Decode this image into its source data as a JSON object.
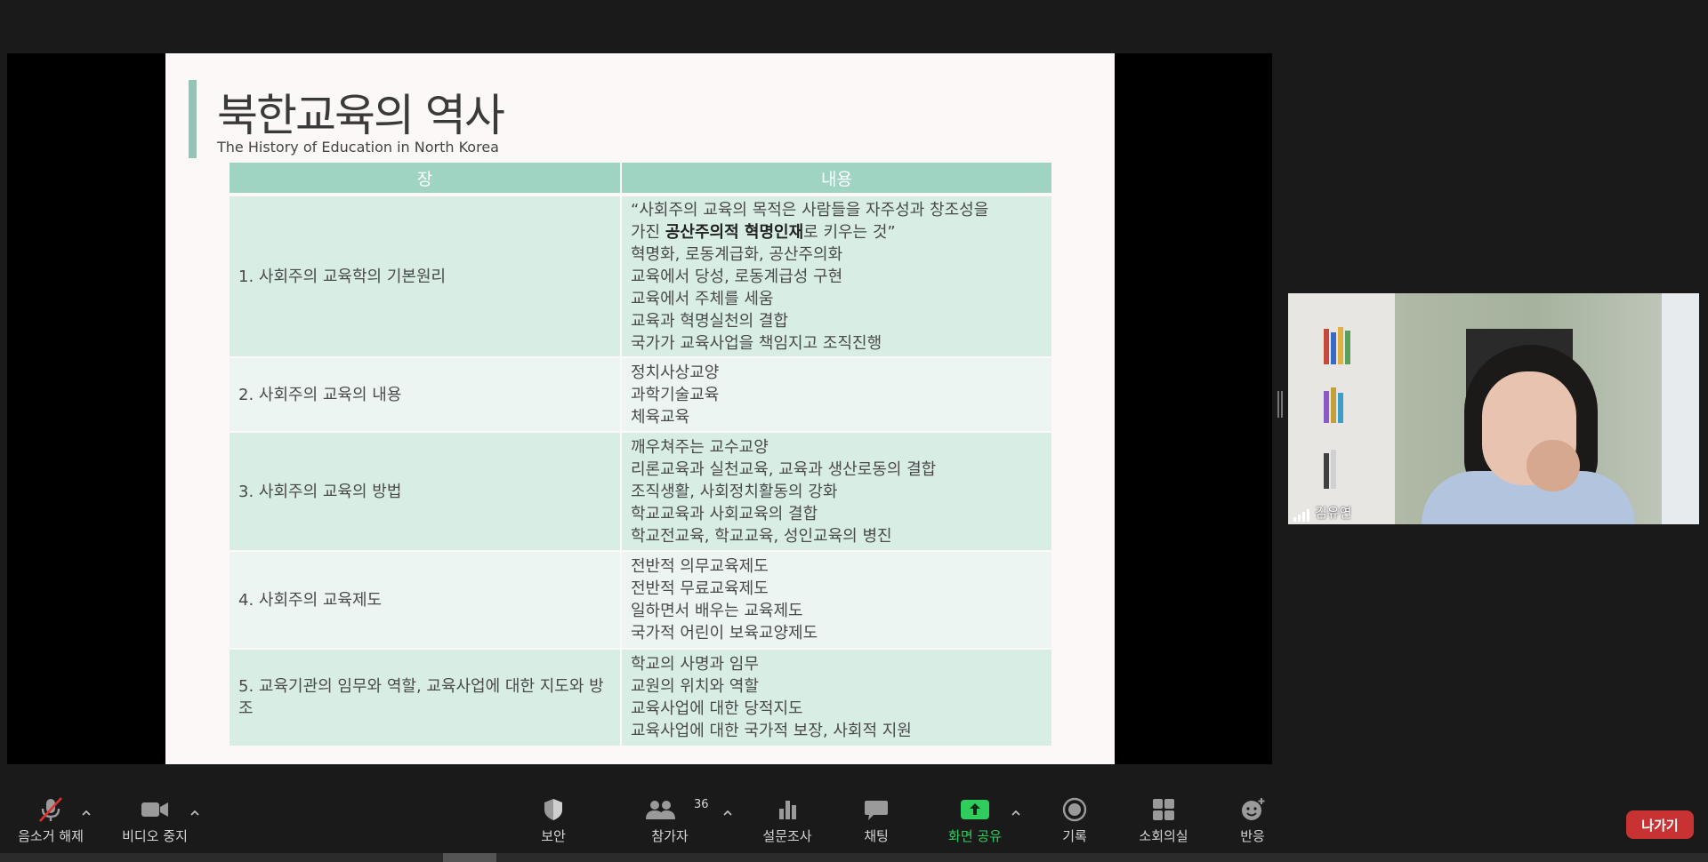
{
  "slide": {
    "title": "북한교육의 역사",
    "subtitle": "The History of Education in North Korea",
    "table": {
      "headers": [
        "장",
        "내용"
      ],
      "rows": [
        {
          "chapter": "1. 사회주의 교육학의 기본원리",
          "lines": [
            "“사회주의 교육의 목적은 사람들을 자주성과 창조성을",
            "가진 ",
            "혁명화, 로동계급화, 공산주의화",
            "교육에서 당성, 로동계급성 구현",
            "교육에서 주체를 세움",
            "교육과 혁명실천의 결합",
            "국가가 교육사업을 책임지고 조직진행"
          ],
          "bold_phrase": "공산주의적 혁명인재",
          "after_bold": "로 키우는 것”"
        },
        {
          "chapter": "2. 사회주의 교육의 내용",
          "lines": [
            "정치사상교양",
            "과학기술교육",
            "체육교육"
          ]
        },
        {
          "chapter": "3. 사회주의 교육의 방법",
          "lines": [
            "깨우쳐주는 교수교양",
            "리론교육과 실천교육, 교육과 생산로동의 결합",
            "조직생활, 사회정치활동의 강화",
            "학교교육과 사회교육의 결합",
            "학교전교육, 학교교육, 성인교육의 병진"
          ]
        },
        {
          "chapter": "4. 사회주의 교육제도",
          "lines": [
            "전반적 의무교육제도",
            "전반적 무료교육제도",
            "일하면서 배우는 교육제도",
            "국가적 어린이 보육교양제도"
          ]
        },
        {
          "chapter": "5. 교육기관의 임무와 역할, 교육사업에 대한 지도와 방조",
          "lines": [
            "학교의 사명과 임무",
            "교원의 위치와 역할",
            "교육사업에 대한 당적지도",
            "교육사업에 대한 국가적 보장, 사회적 지원"
          ]
        }
      ]
    }
  },
  "participant": {
    "name": "김유연"
  },
  "toolbar": {
    "unmute": "음소거 해제",
    "stop_video": "비디오 중지",
    "security": "보안",
    "participants": "참가자",
    "participants_count": "36",
    "polls": "설문조사",
    "chat": "채팅",
    "share_screen": "화면 공유",
    "record": "기록",
    "breakout": "소회의실",
    "reactions": "반응",
    "leave": "나가기"
  },
  "colors": {
    "header": "#9fd4c2",
    "row_odd": "#d8eee5",
    "row_even": "#ecf5f1",
    "share_green": "#2fce5c",
    "leave_red": "#c93232"
  }
}
